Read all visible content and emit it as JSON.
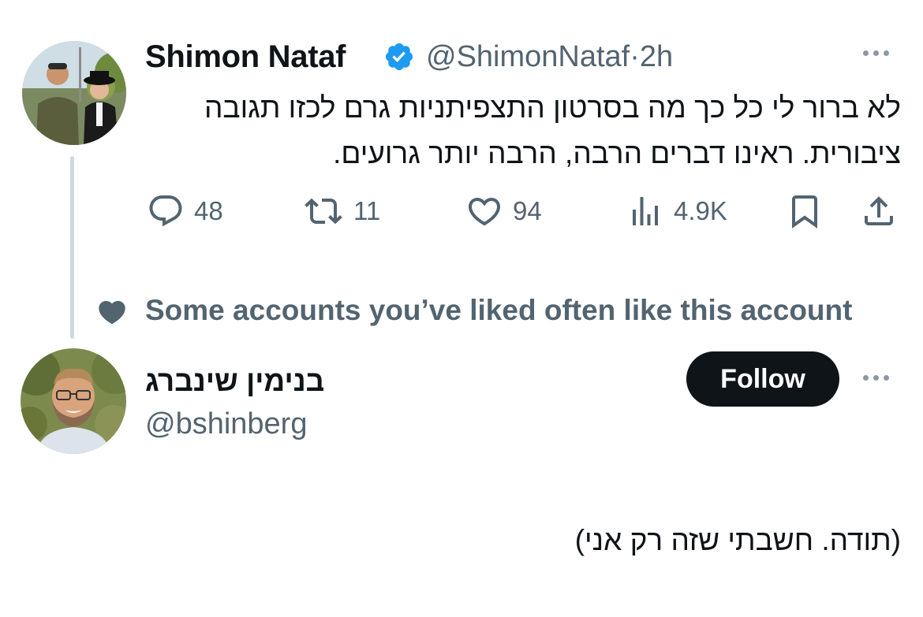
{
  "tweet": {
    "author_name": "Shimon Nataf",
    "handle": "@ShimonNataf",
    "separator": "·",
    "time": "2h",
    "verified": true,
    "text": "לא ברור לי כל כך מה בסרטון התצפיתניות גרם לכזו תגובה ציבורית. ראינו דברים הרבה, הרבה יותר גרועים.",
    "actions": {
      "replies": "48",
      "retweets": "11",
      "likes": "94",
      "views": "4.9K"
    }
  },
  "social_context": {
    "icon": "heart-icon",
    "text": "Some accounts you’ve liked often like this account"
  },
  "suggested": {
    "name": "בנימין שינברג",
    "handle": "@bshinberg",
    "follow_label": "Follow",
    "reply_text": "(תודה. חשבתי שזה רק אני)"
  },
  "colors": {
    "text": "#0f1419",
    "secondary": "#536471",
    "verified": "#1d9bf0",
    "thread_line": "#cfd9de",
    "follow_bg": "#0f1419"
  }
}
